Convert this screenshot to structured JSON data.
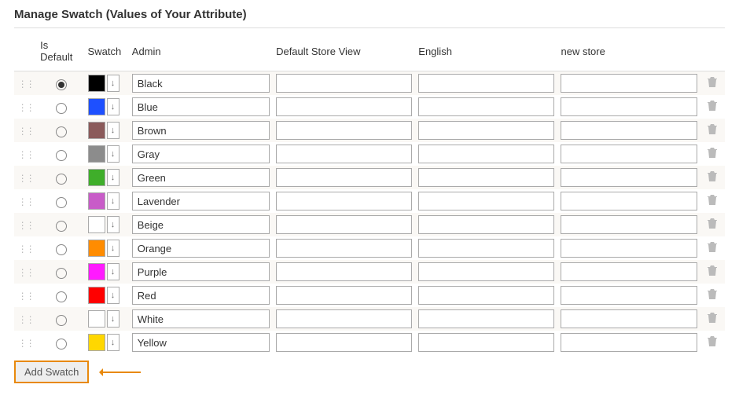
{
  "section_title": "Manage Swatch (Values of Your Attribute)",
  "columns": {
    "is_default": "Is Default",
    "swatch": "Swatch",
    "admin": "Admin",
    "default_store_view": "Default Store View",
    "english": "English",
    "new_store": "new store"
  },
  "rows": [
    {
      "color": "#000000",
      "admin": "Black",
      "default_store_view": "",
      "english": "",
      "new_store": "",
      "is_default": true
    },
    {
      "color": "#1e50ff",
      "admin": "Blue",
      "default_store_view": "",
      "english": "",
      "new_store": "",
      "is_default": false
    },
    {
      "color": "#8b5a5a",
      "admin": "Brown",
      "default_store_view": "",
      "english": "",
      "new_store": "",
      "is_default": false
    },
    {
      "color": "#8c8c8c",
      "admin": "Gray",
      "default_store_view": "",
      "english": "",
      "new_store": "",
      "is_default": false
    },
    {
      "color": "#3fae2a",
      "admin": "Green",
      "default_store_view": "",
      "english": "",
      "new_store": "",
      "is_default": false
    },
    {
      "color": "#c85cc8",
      "admin": "Lavender",
      "default_store_view": "",
      "english": "",
      "new_store": "",
      "is_default": false
    },
    {
      "color": "#ffffff",
      "admin": "Beige",
      "default_store_view": "",
      "english": "",
      "new_store": "",
      "is_default": false
    },
    {
      "color": "#ff8c00",
      "admin": "Orange",
      "default_store_view": "",
      "english": "",
      "new_store": "",
      "is_default": false
    },
    {
      "color": "#ff1aff",
      "admin": "Purple",
      "default_store_view": "",
      "english": "",
      "new_store": "",
      "is_default": false
    },
    {
      "color": "#ff0000",
      "admin": "Red",
      "default_store_view": "",
      "english": "",
      "new_store": "",
      "is_default": false
    },
    {
      "color": "#ffffff",
      "admin": "White",
      "default_store_view": "",
      "english": "",
      "new_store": "",
      "is_default": false
    },
    {
      "color": "#ffd700",
      "admin": "Yellow",
      "default_store_view": "",
      "english": "",
      "new_store": "",
      "is_default": false
    }
  ],
  "add_button_label": "Add Swatch"
}
